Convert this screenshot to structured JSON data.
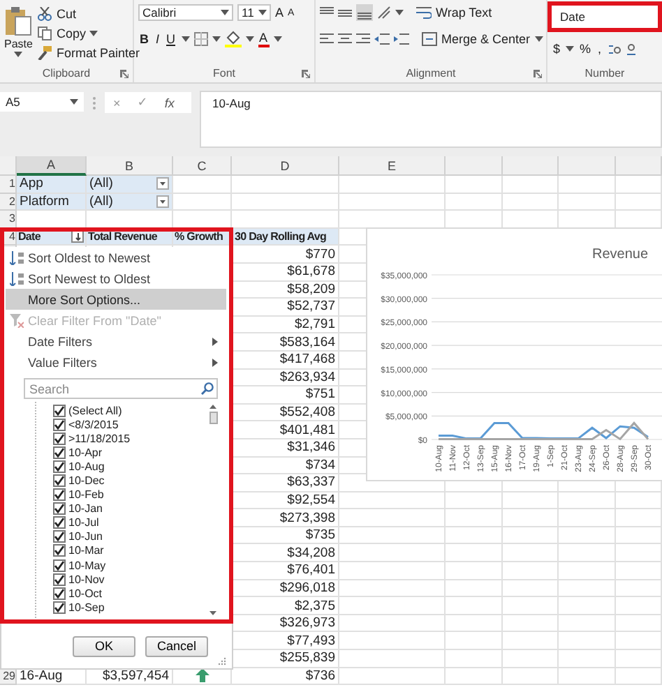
{
  "ribbon": {
    "clipboard": {
      "paste": "Paste",
      "cut": "Cut",
      "copy": "Copy",
      "format_painter": "Format Painter",
      "label": "Clipboard"
    },
    "font": {
      "font_name": "Calibri",
      "font_size": "11",
      "grow": "A",
      "shrink": "A",
      "bold": "B",
      "italic": "I",
      "underline": "U",
      "font_color": "A",
      "label": "Font"
    },
    "alignment": {
      "wrap_text": "Wrap Text",
      "merge_center": "Merge & Center",
      "label": "Alignment"
    },
    "number": {
      "format": "Date",
      "highlighted": true,
      "currency": "$",
      "percent": "%",
      "comma": ",",
      "label": "Number"
    }
  },
  "formula_bar": {
    "name_box": "A5",
    "cancel": "×",
    "enter": "✓",
    "fx": "fx",
    "value": "10-Aug"
  },
  "columns": [
    "A",
    "B",
    "C",
    "D",
    "E"
  ],
  "pivot_filters": [
    {
      "row_number": "1",
      "label": "App",
      "value": "(All)"
    },
    {
      "row_number": "2",
      "label": "Platform",
      "value": "(All)"
    }
  ],
  "blank_row_number": "3",
  "table": {
    "row_number": "4",
    "headers": [
      "Date",
      "Total Revenue",
      "% Growth",
      "30 Day Rolling Avg"
    ],
    "rows": [
      {
        "rolling_avg": "$770"
      },
      {
        "rolling_avg": "$61,678"
      },
      {
        "rolling_avg": "$58,209"
      },
      {
        "rolling_avg": "$52,737"
      },
      {
        "rolling_avg": "$2,791"
      },
      {
        "rolling_avg": "$583,164"
      },
      {
        "rolling_avg": "$417,468"
      },
      {
        "rolling_avg": "$263,934"
      },
      {
        "rolling_avg": "$751"
      },
      {
        "rolling_avg": "$552,408"
      },
      {
        "rolling_avg": "$401,481"
      },
      {
        "rolling_avg": "$31,346"
      },
      {
        "rolling_avg": "$734"
      },
      {
        "rolling_avg": "$63,337"
      },
      {
        "rolling_avg": "$92,554"
      },
      {
        "rolling_avg": "$273,398"
      },
      {
        "rolling_avg": "$735"
      },
      {
        "rolling_avg": "$34,208"
      },
      {
        "rolling_avg": "$76,401"
      },
      {
        "rolling_avg": "$296,018"
      },
      {
        "rolling_avg": "$2,375"
      },
      {
        "rolling_avg": "$326,973"
      },
      {
        "rolling_avg": "$77,493"
      },
      {
        "rolling_avg": "$255,839"
      },
      {
        "row_number": "29",
        "date": "16-Aug",
        "total_revenue": "$3,597,454",
        "trend_up": true,
        "rolling_avg": "$736"
      }
    ]
  },
  "filter_menu": {
    "highlighted": true,
    "items": [
      {
        "kind": "sort-asc",
        "label": "Sort Oldest to Newest",
        "selected": false,
        "disabled": false
      },
      {
        "kind": "sort-desc",
        "label": "Sort Newest to Oldest",
        "selected": false,
        "disabled": false
      },
      {
        "kind": "plain",
        "label": "More Sort Options...",
        "selected": true,
        "disabled": false
      },
      {
        "kind": "clear",
        "label": "Clear Filter From \"Date\"",
        "selected": false,
        "disabled": true
      },
      {
        "kind": "submenu",
        "label": "Date Filters",
        "selected": false,
        "disabled": false
      },
      {
        "kind": "submenu",
        "label": "Value Filters",
        "selected": false,
        "disabled": false
      }
    ],
    "search": {
      "placeholder": "Search"
    },
    "values": [
      {
        "label": "(Select All)",
        "checked": true
      },
      {
        "label": "<8/3/2015",
        "checked": true
      },
      {
        "label": ">11/18/2015",
        "checked": true
      },
      {
        "label": "10-Apr",
        "checked": true
      },
      {
        "label": "10-Aug",
        "checked": true
      },
      {
        "label": "10-Dec",
        "checked": true
      },
      {
        "label": "10-Feb",
        "checked": true
      },
      {
        "label": "10-Jan",
        "checked": true
      },
      {
        "label": "10-Jul",
        "checked": true
      },
      {
        "label": "10-Jun",
        "checked": true
      },
      {
        "label": "10-Mar",
        "checked": true
      },
      {
        "label": "10-May",
        "checked": true
      },
      {
        "label": "10-Nov",
        "checked": true
      },
      {
        "label": "10-Oct",
        "checked": true
      },
      {
        "label": "10-Sep",
        "checked": true
      }
    ],
    "buttons": [
      "OK",
      "Cancel"
    ]
  },
  "chart": {
    "chart_data": {
      "type": "line",
      "title": "Revenue",
      "grid": true,
      "categories": [
        "10-Aug",
        "11-Nov",
        "12-Oct",
        "13-Sep",
        "15-Aug",
        "16-Nov",
        "17-Oct",
        "19-Aug",
        "1-Sep",
        "21-Oct",
        "23-Aug",
        "24-Sep",
        "26-Oct",
        "28-Aug",
        "29-Sep",
        "30-Oct"
      ],
      "yticks": [
        {
          "value": 0,
          "label": "$0"
        },
        {
          "value": 5000000,
          "label": "$5,000,000"
        },
        {
          "value": 10000000,
          "label": "$10,000,000"
        },
        {
          "value": 15000000,
          "label": "$15,000,000"
        },
        {
          "value": 20000000,
          "label": "$20,000,000"
        },
        {
          "value": 25000000,
          "label": "$25,000,000"
        },
        {
          "value": 30000000,
          "label": "$30,000,000"
        },
        {
          "value": 35000000,
          "label": "$35,000,000"
        }
      ],
      "ylim": [
        0,
        35000000
      ],
      "series": [
        {
          "color": "#5b9bd5",
          "values": [
            800000,
            800000,
            200000,
            200000,
            3500000,
            3500000,
            300000,
            300000,
            200000,
            200000,
            200000,
            2500000,
            300000,
            2800000,
            2500000,
            500000
          ]
        },
        {
          "color": "#a5a5a5",
          "values": [
            100000,
            100000,
            100000,
            100000,
            100000,
            100000,
            100000,
            100000,
            100000,
            100000,
            100000,
            100000,
            2000000,
            100000,
            3500000,
            100000
          ]
        }
      ]
    }
  }
}
